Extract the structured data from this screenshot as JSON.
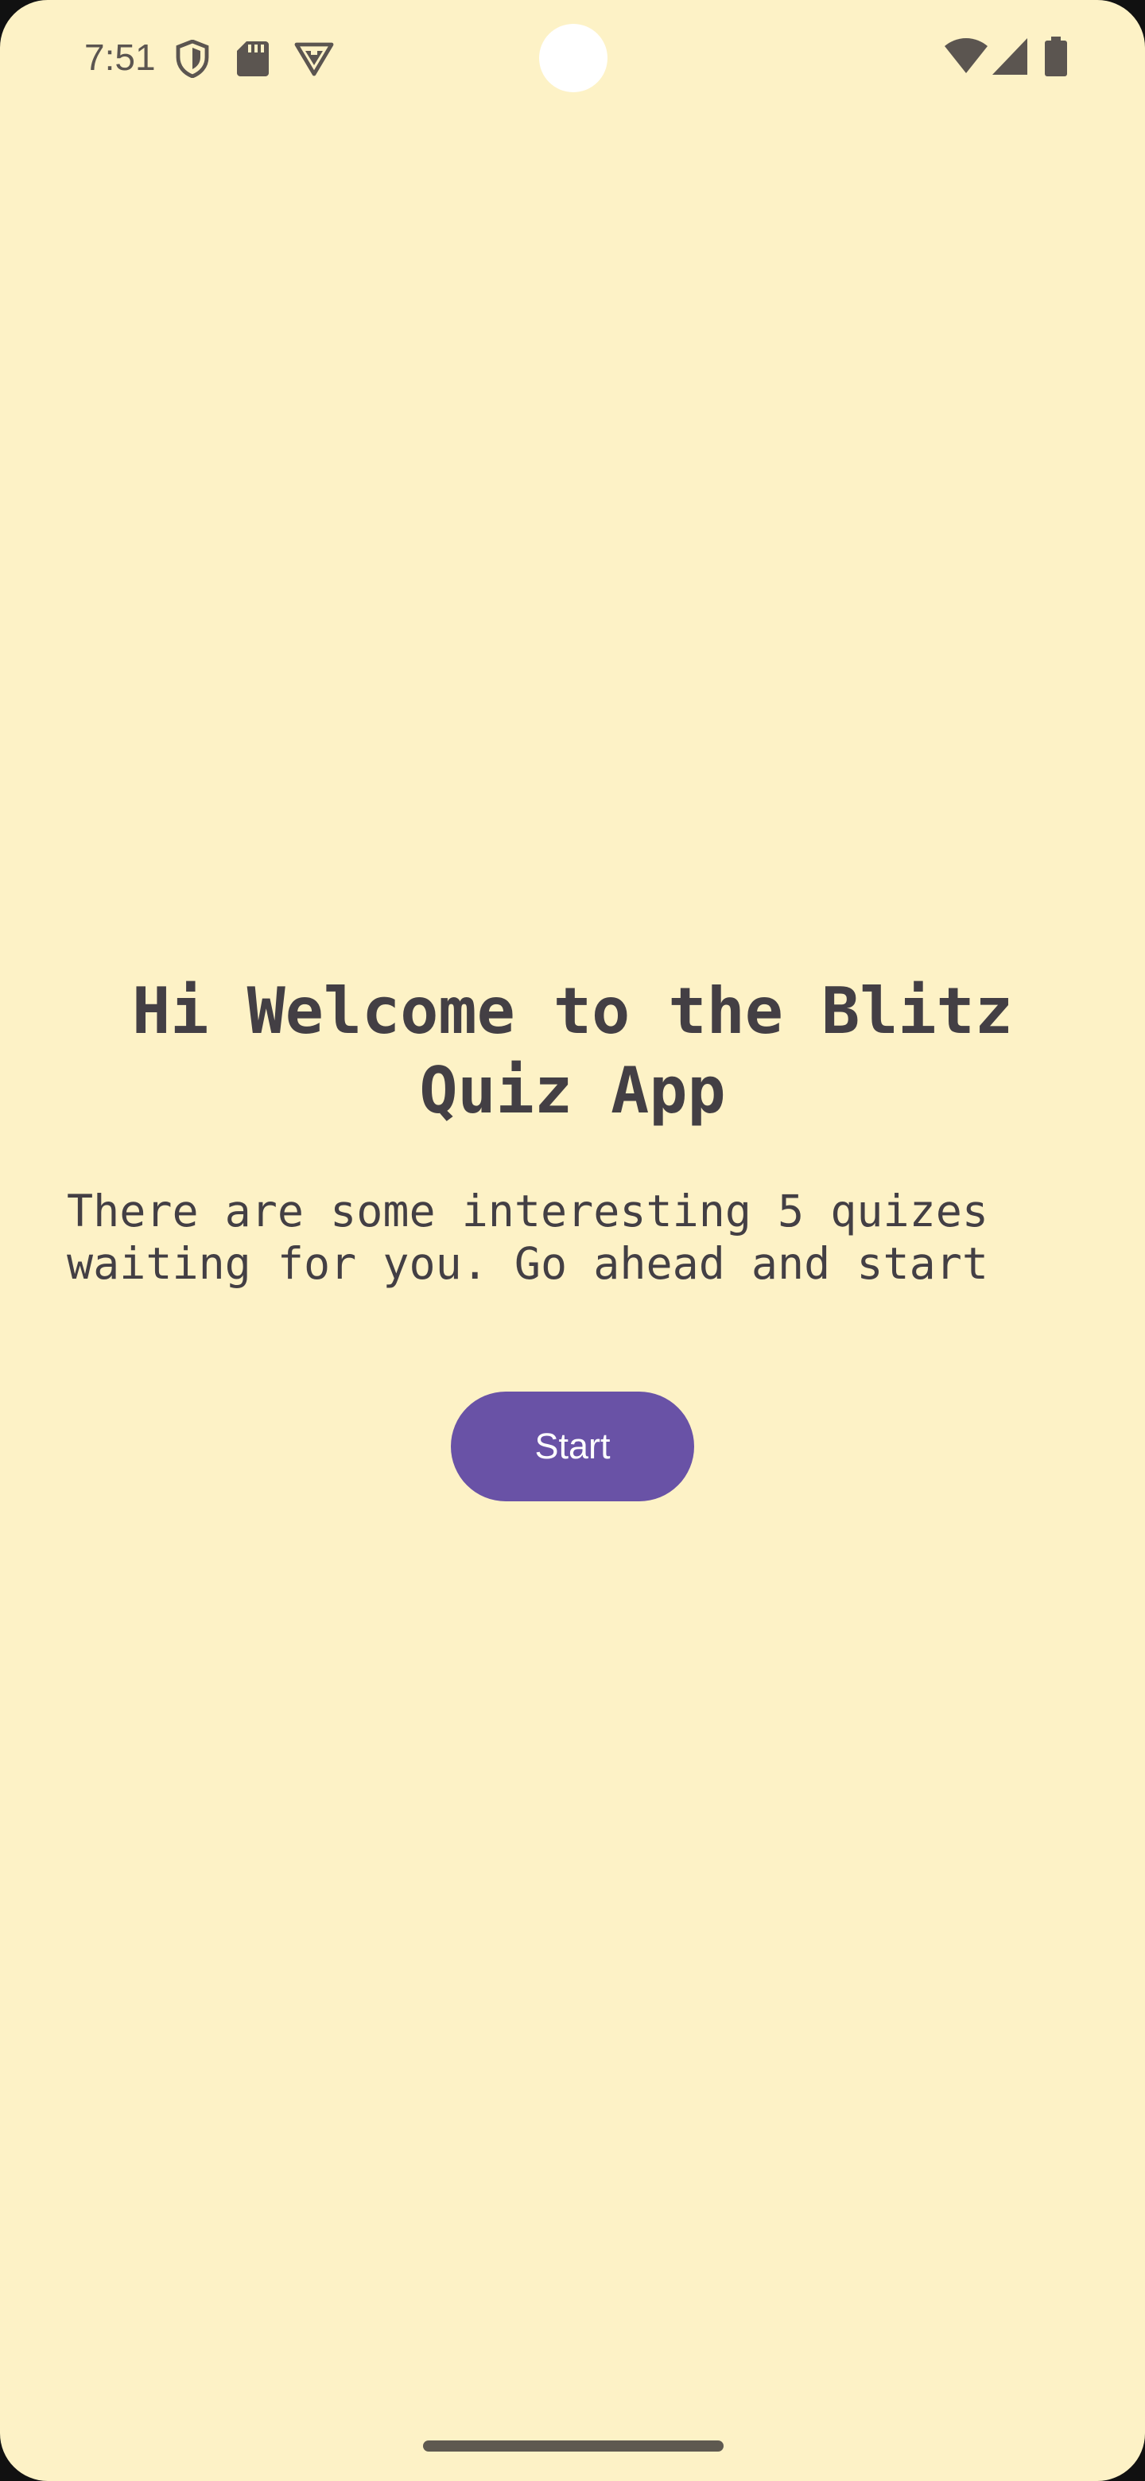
{
  "status_bar": {
    "time": "7:51",
    "left_icons": [
      "shield-icon",
      "sd-card-icon",
      "vpn-triangle-icon"
    ],
    "right_icons": [
      "wifi-icon",
      "cellular-signal-icon",
      "battery-icon"
    ]
  },
  "main": {
    "title": "Hi Welcome to the Blitz Quiz App",
    "subtitle": "There are some interesting 5 quizes waiting for you. Go ahead and start",
    "start_button_label": "Start"
  },
  "colors": {
    "background": "#fdf2c6",
    "text": "#433f44",
    "accent": "#6952a6",
    "status_icons": "#5b5550"
  }
}
